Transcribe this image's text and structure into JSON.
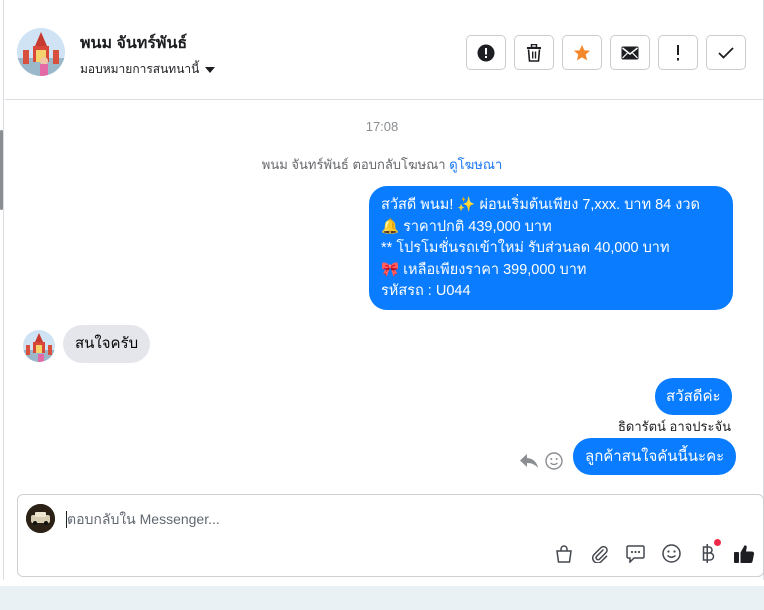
{
  "header": {
    "name": "พนม จันทร์พันธ์",
    "assign_label": "มอบหมายการสนทนานี้",
    "actions": [
      {
        "name": "spam-button",
        "icon": "alert-circle-icon"
      },
      {
        "name": "delete-button",
        "icon": "trash-icon"
      },
      {
        "name": "star-button",
        "icon": "star-icon"
      },
      {
        "name": "mark-unread-button",
        "icon": "envelope-icon"
      },
      {
        "name": "follow-up-button",
        "icon": "exclamation-icon"
      },
      {
        "name": "mark-done-button",
        "icon": "check-icon"
      }
    ]
  },
  "thread": {
    "time": "17:08",
    "ad_reply_text": "พนม จันทร์พันธ์ ตอบกลับโฆษณา",
    "ad_link": "ดูโฆษณา",
    "promo_lines": [
      "สวัสดี พนม! ✨  ผ่อนเริ่มต้นเพียง 7,xxx. บาท 84 งวด",
      "🔔 ราคาปกติ 439,000 บาท",
      "** โปรโมชั่นรถเข้าใหม่ รับส่วนลด 40,000 บาท",
      "🎀  เหลือเพียงราคา 399,000 บาท",
      " รหัสรถ : U044"
    ],
    "incoming_message": "สนใจครับ",
    "hello_message": "สวัสดีค่ะ",
    "agent_name": "ธิดารัตน์ อาจประจัน",
    "interest_message": "ลูกค้าสนใจคันนี้นะคะ"
  },
  "composer": {
    "placeholder": "ตอบกลับใน Messenger..."
  },
  "colors": {
    "accent": "#0a7cff",
    "star": "#f5872b",
    "badge": "#f02849"
  }
}
